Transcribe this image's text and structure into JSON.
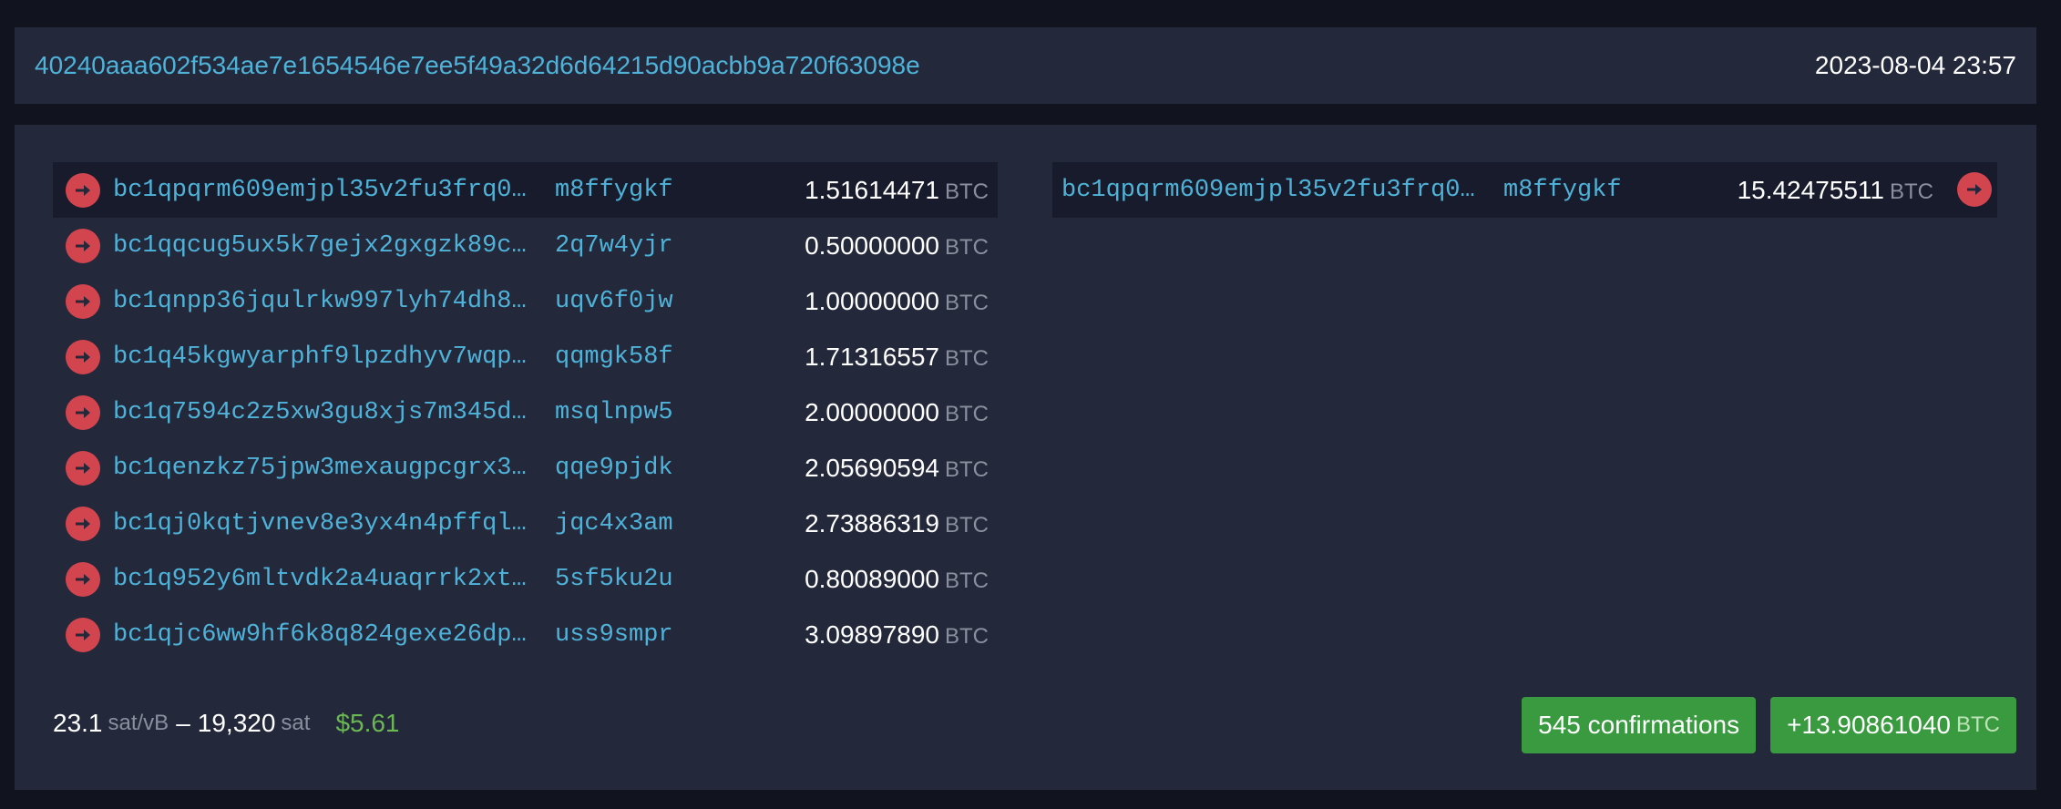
{
  "header": {
    "txid": "40240aaa602f534ae7e1654546e7ee5f49a32d6d64215d90acbb9a720f63098e",
    "timestamp": "2023-08-04 23:57"
  },
  "unit": "BTC",
  "inputs": [
    {
      "addr_start": "bc1qpqrm609emjpl35v2fu3frq0…",
      "addr_end": "m8ffygkf",
      "amount": "1.51614471"
    },
    {
      "addr_start": "bc1qqcug5ux5k7gejx2gxgzk89c…",
      "addr_end": "2q7w4yjr",
      "amount": "0.50000000"
    },
    {
      "addr_start": "bc1qnpp36jqulrkw997lyh74dh8…",
      "addr_end": "uqv6f0jw",
      "amount": "1.00000000"
    },
    {
      "addr_start": "bc1q45kgwyarphf9lpzdhyv7wqp…",
      "addr_end": "qqmgk58f",
      "amount": "1.71316557"
    },
    {
      "addr_start": "bc1q7594c2z5xw3gu8xjs7m345d…",
      "addr_end": "msqlnpw5",
      "amount": "2.00000000"
    },
    {
      "addr_start": "bc1qenzkz75jpw3mexaugpcgrx3…",
      "addr_end": "qqe9pjdk",
      "amount": "2.05690594"
    },
    {
      "addr_start": "bc1qj0kqtjvnev8e3yx4n4pffql…",
      "addr_end": "jqc4x3am",
      "amount": "2.73886319"
    },
    {
      "addr_start": "bc1q952y6mltvdk2a4uaqrrk2xt…",
      "addr_end": "5sf5ku2u",
      "amount": "0.80089000"
    },
    {
      "addr_start": "bc1qjc6ww9hf6k8q824gexe26dp…",
      "addr_end": "uss9smpr",
      "amount": "3.09897890"
    }
  ],
  "outputs": [
    {
      "addr_start": "bc1qpqrm609emjpl35v2fu3frq0…",
      "addr_end": "m8ffygkf",
      "amount": "15.42475511"
    }
  ],
  "footer": {
    "fee_rate": "23.1",
    "fee_rate_unit": "sat/vB",
    "separator": "–",
    "fee": "19,320",
    "fee_unit": "sat",
    "fiat": "$5.61"
  },
  "badges": {
    "confirmations": "545 confirmations",
    "net_amount": "+13.90861040"
  },
  "colors": {
    "accent": "#4fb3d9",
    "arrow": "#d3454e",
    "success": "#3a9a40",
    "fiat": "#6ab753"
  },
  "icons": {
    "row_icon": "arrow-right-circle-icon"
  }
}
